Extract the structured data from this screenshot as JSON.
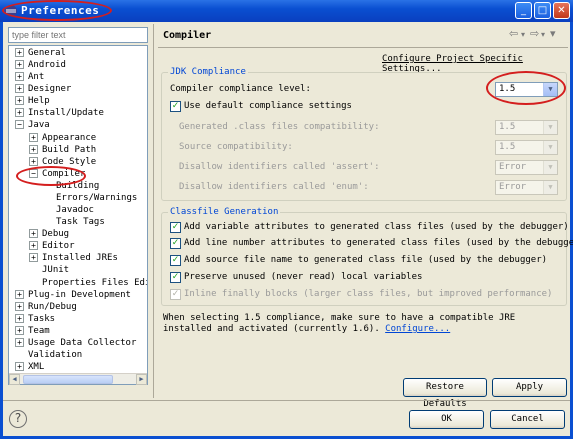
{
  "window": {
    "title": "Preferences"
  },
  "title_buttons": {
    "minimize": "_",
    "maximize": "□",
    "close": "✕"
  },
  "filter": {
    "placeholder": "type filter text"
  },
  "tree": {
    "items": [
      {
        "label": "General",
        "toggle": "+"
      },
      {
        "label": "Android",
        "toggle": "+"
      },
      {
        "label": "Ant",
        "toggle": "+"
      },
      {
        "label": "Designer",
        "toggle": "+"
      },
      {
        "label": "Help",
        "toggle": "+"
      },
      {
        "label": "Install/Update",
        "toggle": "+"
      },
      {
        "label": "Java",
        "toggle": "−"
      },
      {
        "label": "Appearance",
        "toggle": "+"
      },
      {
        "label": "Build Path",
        "toggle": "+"
      },
      {
        "label": "Code Style",
        "toggle": "+"
      },
      {
        "label": "Compiler",
        "toggle": "−"
      },
      {
        "label": "Building",
        "toggle": ""
      },
      {
        "label": "Errors/Warnings",
        "toggle": ""
      },
      {
        "label": "Javadoc",
        "toggle": ""
      },
      {
        "label": "Task Tags",
        "toggle": ""
      },
      {
        "label": "Debug",
        "toggle": "+"
      },
      {
        "label": "Editor",
        "toggle": "+"
      },
      {
        "label": "Installed JREs",
        "toggle": "+"
      },
      {
        "label": "JUnit",
        "toggle": ""
      },
      {
        "label": "Properties Files Edit",
        "toggle": ""
      },
      {
        "label": "Plug-in Development",
        "toggle": "+"
      },
      {
        "label": "Run/Debug",
        "toggle": "+"
      },
      {
        "label": "Tasks",
        "toggle": "+"
      },
      {
        "label": "Team",
        "toggle": "+"
      },
      {
        "label": "Usage Data Collector",
        "toggle": "+"
      },
      {
        "label": "Validation",
        "toggle": ""
      },
      {
        "label": "XML",
        "toggle": "+"
      }
    ]
  },
  "page": {
    "title": "Compiler",
    "configure_link": "Configure Project Specific Settings...",
    "nav": {
      "back": "⇦",
      "forward": "⇨",
      "menu": "▾"
    }
  },
  "jdk": {
    "group_label": "JDK Compliance",
    "compliance_label": "Compiler compliance level:",
    "compliance_value": "1.5",
    "use_default_label": "Use default compliance settings",
    "use_default_checked": "✓",
    "rows": [
      {
        "label": "Generated .class files compatibility:",
        "value": "1.5"
      },
      {
        "label": "Source compatibility:",
        "value": "1.5"
      },
      {
        "label": "Disallow identifiers called 'assert':",
        "value": "Error"
      },
      {
        "label": "Disallow identifiers called 'enum':",
        "value": "Error"
      }
    ]
  },
  "classfile": {
    "group_label": "Classfile Generation",
    "options": [
      {
        "label": "Add variable attributes to generated class files (used by the debugger)",
        "mark": "✓"
      },
      {
        "label": "Add line number attributes to generated class files (used by the debugger)",
        "mark": "✓"
      },
      {
        "label": "Add source file name to generated class file (used by the debugger)",
        "mark": "✓"
      },
      {
        "label": "Preserve unused (never read) local variables",
        "mark": "✓"
      },
      {
        "label": "Inline finally blocks (larger class files, but improved performance)",
        "mark": "✓"
      }
    ]
  },
  "note": {
    "text": "When selecting 1.5 compliance, make sure to have a compatible JRE installed and activated (currently 1.6).",
    "link": "Configure..."
  },
  "buttons": {
    "restore_defaults": "Restore Defaults",
    "apply": "Apply",
    "ok": "OK",
    "cancel": "Cancel",
    "help": "?"
  },
  "colors": {
    "title_bar": "#0a4fd1",
    "annotation": "#d41e1e",
    "group_label": "#0046d5"
  }
}
